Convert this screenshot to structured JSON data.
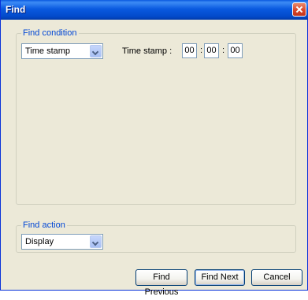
{
  "window": {
    "title": "Find"
  },
  "find_condition": {
    "legend": "Find condition",
    "type_select": "Time stamp",
    "time_label": "Time stamp :",
    "hours": "00",
    "minutes": "00",
    "seconds": "00"
  },
  "find_action": {
    "legend": "Find action",
    "action_select": "Display"
  },
  "buttons": {
    "previous": "Find Previous",
    "next": "Find Next",
    "cancel": "Cancel"
  },
  "colors": {
    "titlebar": "#0a5ae0",
    "dialog_bg": "#ece9d8",
    "legend_text": "#0046d5",
    "close_button": "#d9472a"
  }
}
